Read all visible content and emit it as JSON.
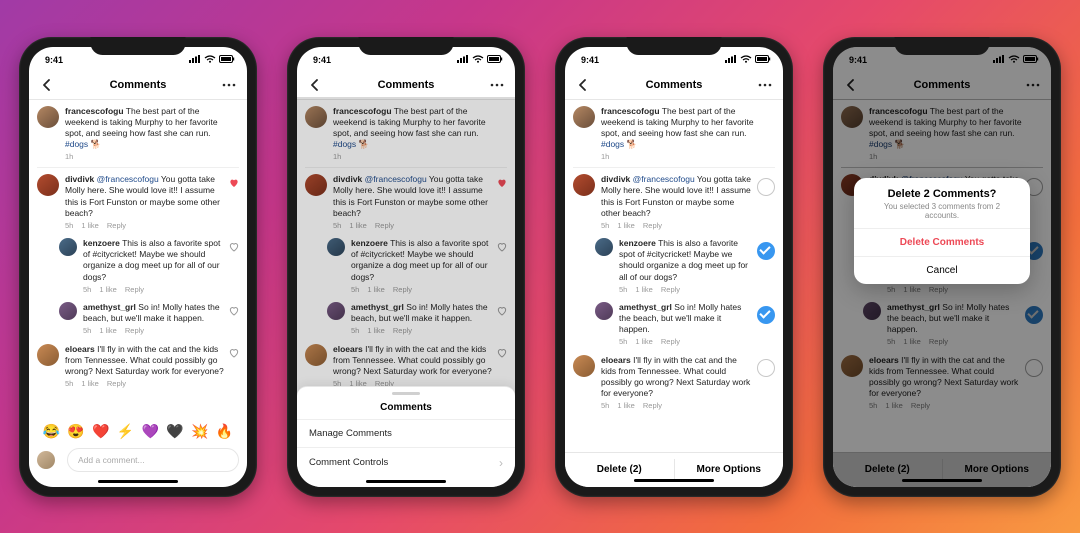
{
  "statusbar": {
    "time": "9:41"
  },
  "navbar": {
    "title": "Comments"
  },
  "post": {
    "author": "francescofogu",
    "text": "The best part of the weekend is taking Murphy to her favorite spot, and seeing how fast she can run.",
    "hashtag": "#dogs",
    "emoji": "🐕",
    "time": "1h"
  },
  "comments": [
    {
      "author": "divdivk",
      "mention": "@francescofogu",
      "text": "You gotta take Molly here. She would love it!! I assume this is Fort Funston or maybe some other beach?",
      "time": "5h",
      "likes": "1 like",
      "reply": "Reply",
      "liked": true
    },
    {
      "author": "kenzoere",
      "text": "This is also a favorite spot of #citycricket! Maybe we should organize a dog meet up for all of our dogs?",
      "time": "5h",
      "likes": "1 like",
      "reply": "Reply",
      "indent": true
    },
    {
      "author": "amethyst_grl",
      "text": "So in! Molly hates the beach, but we'll make it happen.",
      "time": "5h",
      "likes": "1 like",
      "reply": "Reply",
      "indent": true
    },
    {
      "author": "eloears",
      "text": "I'll fly in with the cat and the kids from Tennessee. What could possibly go wrong? Next Saturday work for everyone?",
      "time": "5h",
      "likes": "1 like",
      "reply": "Reply"
    }
  ],
  "emoji_row": [
    "😂",
    "😍",
    "❤️",
    "⚡",
    "💜",
    "🖤",
    "💥",
    "🔥"
  ],
  "composer": {
    "placeholder": "Add a comment..."
  },
  "sheet": {
    "title": "Comments",
    "manage": "Manage Comments",
    "controls": "Comment Controls"
  },
  "selection": {
    "checked": [
      false,
      true,
      true,
      false
    ],
    "delete": "Delete (2)",
    "more": "More Options"
  },
  "alert": {
    "title": "Delete 2 Comments?",
    "subtitle": "You selected 3 comments from 2 accounts.",
    "delete": "Delete Comments",
    "cancel": "Cancel"
  },
  "avatars": [
    "#8a6d5a",
    "#b34c2f",
    "#4a6b88",
    "#7a5c86",
    "#c98a54",
    "#d1b89a"
  ]
}
